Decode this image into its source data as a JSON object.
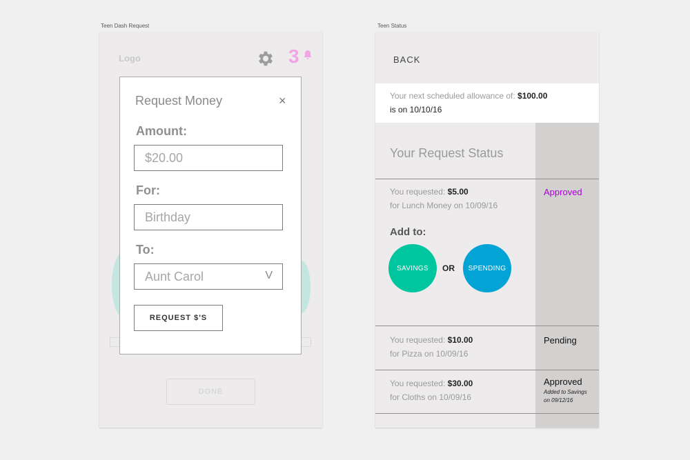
{
  "left": {
    "artboard_label": "Teen Dash Request",
    "logo": "Logo",
    "notification_count": "3",
    "modal": {
      "title": "Request Money",
      "close": "×",
      "amount_label": "Amount:",
      "amount_value": "$20.00",
      "for_label": "For:",
      "for_value": "Birthday",
      "to_label": "To:",
      "to_value": "Aunt Carol",
      "to_chevron": "V",
      "submit": "REQUEST $'S"
    },
    "done": "DONE"
  },
  "right": {
    "artboard_label": "Teen Status",
    "back": "BACK",
    "allowance": {
      "prefix": "Your next scheduled allowance of:",
      "amount": "$100.00",
      "date_line": "is on 10/10/16"
    },
    "status_title": "Your Request Status",
    "requests": [
      {
        "prefix": "You requested:",
        "amount": "$5.00",
        "detail": "for Lunch Money on 10/09/16",
        "status": "Approved",
        "status_color": "#a700d6"
      },
      {
        "prefix": "You requested:",
        "amount": "$10.00",
        "detail": "for Pizza on 10/09/16",
        "status": "Pending"
      },
      {
        "prefix": "You requested:",
        "amount": "$30.00",
        "detail": "for Cloths on 10/09/16",
        "status": "Approved",
        "note_line1": "Added to Savings",
        "note_line2": "on 09/12/16"
      }
    ],
    "add_to": "Add to:",
    "savings": "SAVINGS",
    "or": "OR",
    "spending": "SPENDING",
    "colors": {
      "savings": "#00c6a0",
      "spending": "#03a3d6",
      "notification": "#f0a6e6"
    }
  }
}
